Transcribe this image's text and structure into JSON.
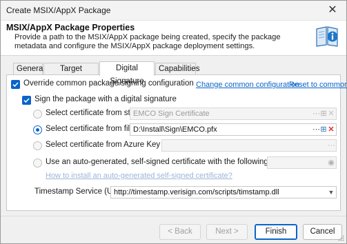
{
  "window": {
    "title": "Create MSIX/AppX Package"
  },
  "header": {
    "title": "MSIX/AppX Package Properties",
    "description": "Provide a path to the MSIX/AppX package being created, specify the package metadata and configure the MSIX/AppX package deployment settings."
  },
  "tabs": [
    {
      "label": "General",
      "active": false
    },
    {
      "label": "Target Platforms",
      "active": false
    },
    {
      "label": "Digital Signature",
      "active": true
    },
    {
      "label": "Capabilities",
      "active": false
    }
  ],
  "signing": {
    "override_label": "Override common package signing configuration",
    "override_checked": true,
    "change_common_link": "Change common configuration",
    "reset_link": "Reset to common",
    "sign_label": "Sign the package with a digital signature",
    "sign_checked": true,
    "options": {
      "store": {
        "label": "Select certificate from store:",
        "value": "EMCO Sign Certificate",
        "selected": false,
        "enabled": false
      },
      "file": {
        "label": "Select certificate from file:",
        "value": "D:\\Install\\Sign\\EMCO.pfx",
        "selected": true,
        "enabled": true
      },
      "azure": {
        "label": "Select certificate from Azure Key Vault:",
        "value": "",
        "selected": false,
        "enabled": false
      },
      "auto": {
        "label": "Use an auto-generated, self-signed certificate with the following password:",
        "value": "",
        "selected": false,
        "enabled": false
      }
    },
    "how_to_link": "How to install an auto-generated self-signed certificate?",
    "timestamp_label": "Timestamp Service (URL):",
    "timestamp_value": "http://timestamp.verisign.com/scripts/timstamp.dll"
  },
  "buttons": {
    "back": "< Back",
    "next": "Next >",
    "finish": "Finish",
    "cancel": "Cancel"
  },
  "colors": {
    "accent": "#0a64c8",
    "remove": "#d9342b"
  }
}
